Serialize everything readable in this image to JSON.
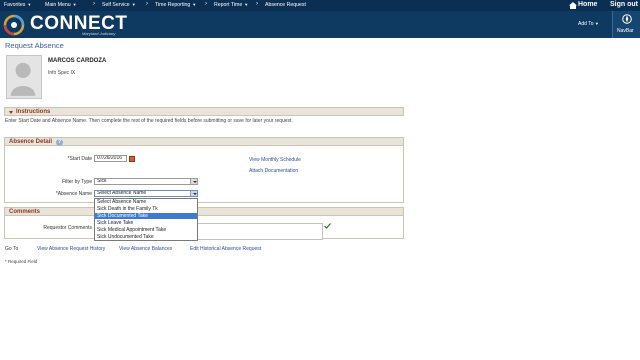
{
  "menubar": {
    "favorites": "Favorites",
    "main_menu": "Main Menu",
    "self_service": "Self Service",
    "time_reporting": "Time Reporting",
    "report_time": "Report Time",
    "absence_request": "Absence Request",
    "separator": "›",
    "home": "Home",
    "sign_out": "Sign out"
  },
  "header": {
    "brand": "CONNECT",
    "brand_sub": "Maryland Judiciary",
    "add_to": "Add To",
    "navbar": "NavBar"
  },
  "page": {
    "title": "Request Absence"
  },
  "employee": {
    "name": "MARCOS CARDOZA",
    "job_title": "Info Spec IX"
  },
  "instructions": {
    "title": "Instructions",
    "text": "Enter Start Date and Absence Name. Then complete the rest of the required fields before submitting or save for later your request."
  },
  "absence_detail": {
    "title": "Absence Detail",
    "help": "?",
    "start_date_label": "*Start Date",
    "start_date_value": "07/26/2016",
    "filter_label": "Filter by Type",
    "filter_value": "Sick",
    "absence_name_label": "*Absence Name",
    "absence_name_value": "Select Absence Name",
    "view_monthly_schedule": "View Monthly Schedule",
    "attach_documentation": "Attach Documentation",
    "options": [
      "Select Absence Name",
      "Sick Death in the Family Tk",
      "Sick Documented Take",
      "Sick Leave Take",
      "Sick Medical Appointment Take",
      "Sick Undocumented Take"
    ],
    "highlighted_option_index": 2
  },
  "comments": {
    "title": "Comments",
    "requestor_label": "Requestor Comments"
  },
  "goto": {
    "label": "Go To",
    "links": [
      "View Absence Request History",
      "View Absence Balances",
      "Edit Historical Absence Request"
    ]
  },
  "footer": {
    "required_note": "* Required Field"
  },
  "colors": {
    "menubar_bg": "#0b2f52",
    "banner_bg": "#0e3a62",
    "section_title": "#8b3a22",
    "link": "#2a4f9c",
    "highlight": "#3d7bd1"
  }
}
